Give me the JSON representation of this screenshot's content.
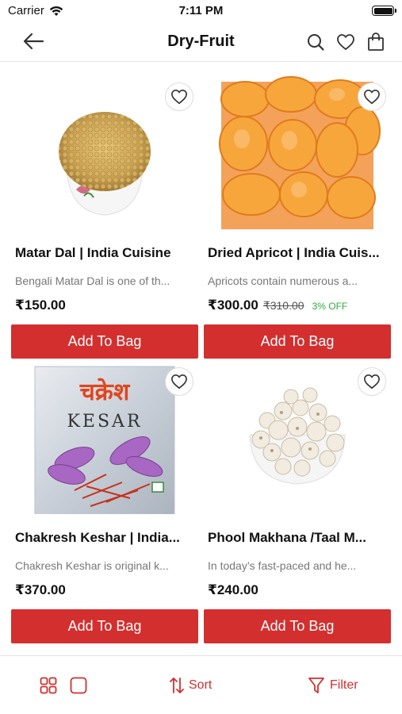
{
  "status_bar": {
    "carrier": "Carrier",
    "time": "7:11 PM"
  },
  "nav": {
    "title": "Dry-Fruit"
  },
  "products": [
    {
      "title": "Matar Dal | India Cuisine",
      "description": "Bengali Matar Dal is one of th...",
      "price": "₹150.00",
      "mrp": "",
      "discount": "",
      "button": "Add To Bag",
      "image": "matar-dal-bowl"
    },
    {
      "title": "Dried Apricot | India Cuis...",
      "description": "Apricots contain numerous a...",
      "price": "₹300.00",
      "mrp": "₹310.00",
      "discount": "3% OFF",
      "button": "Add To Bag",
      "image": "dried-apricots"
    },
    {
      "title": "Chakresh Keshar | India...",
      "description": "Chakresh Keshar is original k...",
      "price": "₹370.00",
      "mrp": "",
      "discount": "",
      "button": "Add To Bag",
      "image": "kesar-packet",
      "packet_text": {
        "brand": "चक्रेश",
        "name": "KESAR"
      }
    },
    {
      "title": "Phool Makhana /Taal M...",
      "description": "In today’s fast-paced and he...",
      "price": "₹240.00",
      "mrp": "",
      "discount": "",
      "button": "Add To Bag",
      "image": "makhana-bowl"
    }
  ],
  "bottom_bar": {
    "sort_label": "Sort",
    "filter_label": "Filter"
  },
  "colors": {
    "accent": "#d32f2f",
    "discount": "#2faa3c"
  }
}
